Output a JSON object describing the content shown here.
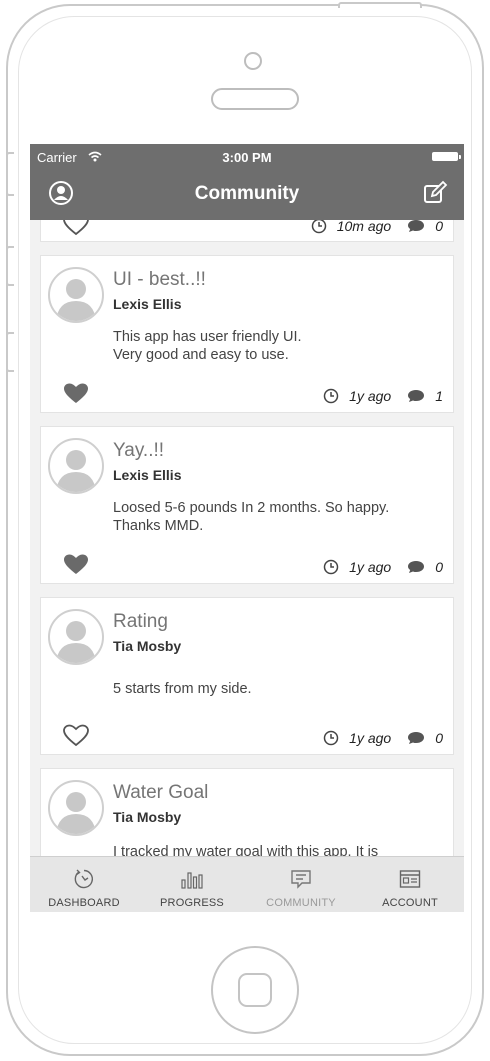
{
  "status_bar": {
    "carrier": "Carrier",
    "time": "3:00 PM"
  },
  "nav": {
    "title": "Community",
    "left_icon": "profile-icon",
    "right_icon": "compose-icon"
  },
  "posts": [
    {
      "title": "",
      "author": "",
      "body_line1": "",
      "body_line2": "",
      "liked": false,
      "time": "10m ago",
      "comments": "0"
    },
    {
      "title": "UI - best..!!",
      "author": "Lexis Ellis",
      "body_line1": "This app has user friendly UI.",
      "body_line2": "Very good and easy to use.",
      "liked": true,
      "time": "1y ago",
      "comments": "1"
    },
    {
      "title": "Yay..!!",
      "author": "Lexis Ellis",
      "body_line1": "Loosed 5-6 pounds In 2 months. So happy.",
      "body_line2": "Thanks MMD.",
      "liked": true,
      "time": "1y ago",
      "comments": "0"
    },
    {
      "title": "Rating",
      "author": "Tia Mosby",
      "body_line1": "5 starts from my side.",
      "body_line2": "",
      "liked": false,
      "time": "1y ago",
      "comments": "0"
    },
    {
      "title": "Water Goal",
      "author": "Tia Mosby",
      "body_line1": "I tracked my water goal with this app. It is",
      "body_line2": "",
      "liked": false,
      "time": "",
      "comments": ""
    }
  ],
  "tabs": [
    {
      "label": "DASHBOARD",
      "icon": "dashboard-icon",
      "active": false
    },
    {
      "label": "PROGRESS",
      "icon": "progress-icon",
      "active": false
    },
    {
      "label": "COMMUNITY",
      "icon": "community-icon",
      "active": true
    },
    {
      "label": "ACCOUNT",
      "icon": "account-icon",
      "active": false
    }
  ],
  "colors": {
    "header": "#6e6e6e",
    "tabbar": "#e6e6e6",
    "active_tab": "#9a9a9a",
    "heart_filled": "#6a6a6a"
  }
}
